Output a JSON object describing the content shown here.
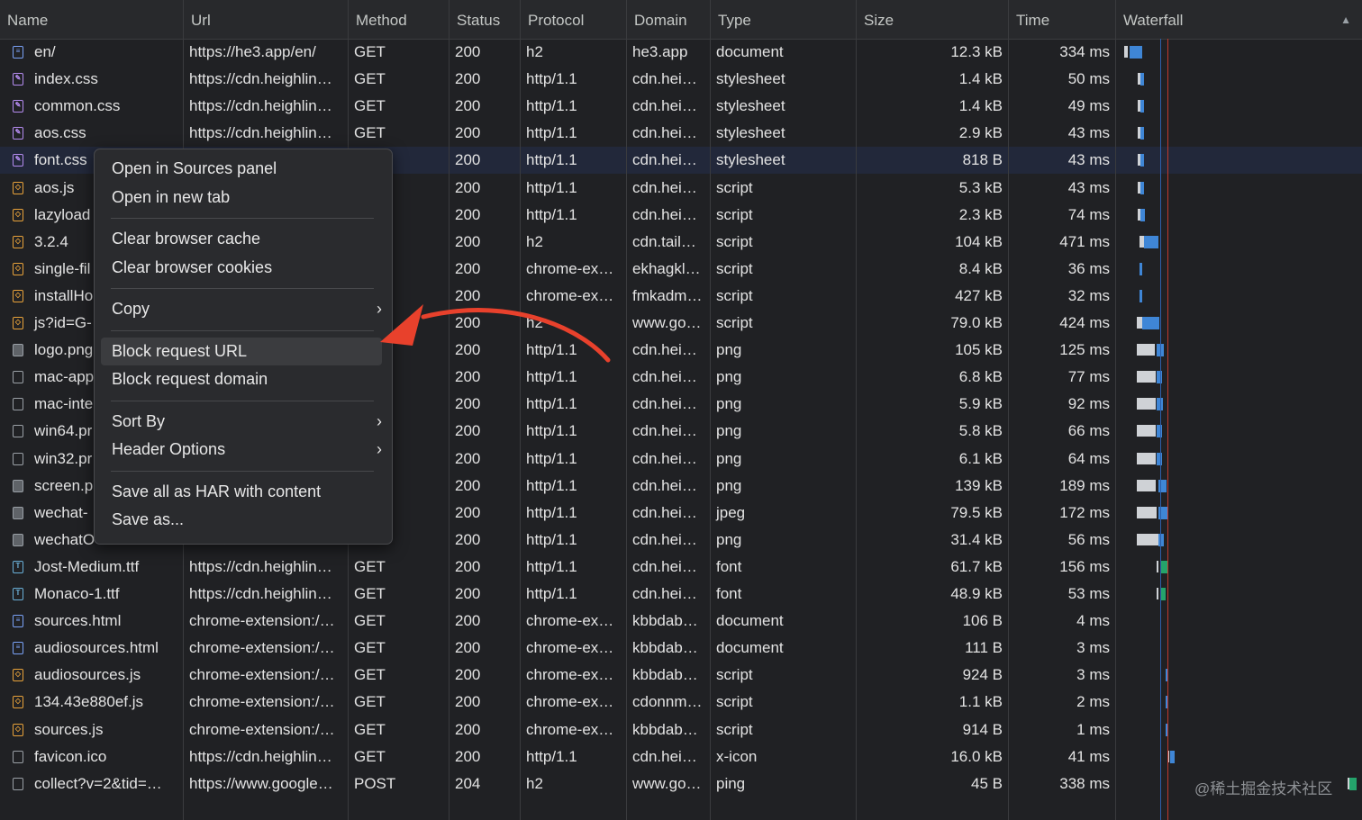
{
  "columns": [
    "Name",
    "Url",
    "Method",
    "Status",
    "Protocol",
    "Domain",
    "Type",
    "Size",
    "Time",
    "Waterfall"
  ],
  "sort_indicator": "▲",
  "rows": [
    {
      "icon": "doc",
      "name": "en/",
      "url": "https://he3.app/en/",
      "method": "GET",
      "status": "200",
      "protocol": "h2",
      "domain": "he3.app",
      "type": "document",
      "size": "12.3 kB",
      "time": "334 ms"
    },
    {
      "icon": "css",
      "name": "index.css",
      "url": "https://cdn.heighlin…",
      "method": "GET",
      "status": "200",
      "protocol": "http/1.1",
      "domain": "cdn.hei…",
      "type": "stylesheet",
      "size": "1.4 kB",
      "time": "50 ms"
    },
    {
      "icon": "css",
      "name": "common.css",
      "url": "https://cdn.heighlin…",
      "method": "GET",
      "status": "200",
      "protocol": "http/1.1",
      "domain": "cdn.hei…",
      "type": "stylesheet",
      "size": "1.4 kB",
      "time": "49 ms"
    },
    {
      "icon": "css",
      "name": "aos.css",
      "url": "https://cdn.heighlin…",
      "method": "GET",
      "status": "200",
      "protocol": "http/1.1",
      "domain": "cdn.hei…",
      "type": "stylesheet",
      "size": "2.9 kB",
      "time": "43 ms"
    },
    {
      "icon": "css",
      "name": "font.css",
      "url": "",
      "method": "",
      "status": "200",
      "protocol": "http/1.1",
      "domain": "cdn.hei…",
      "type": "stylesheet",
      "size": "818 B",
      "time": "43 ms"
    },
    {
      "icon": "js",
      "name": "aos.js",
      "url": "",
      "method": "",
      "status": "200",
      "protocol": "http/1.1",
      "domain": "cdn.hei…",
      "type": "script",
      "size": "5.3 kB",
      "time": "43 ms"
    },
    {
      "icon": "js",
      "name": "lazyload",
      "url": "",
      "method": "",
      "status": "200",
      "protocol": "http/1.1",
      "domain": "cdn.hei…",
      "type": "script",
      "size": "2.3 kB",
      "time": "74 ms"
    },
    {
      "icon": "js",
      "name": "3.2.4",
      "url": "",
      "method": "",
      "status": "200",
      "protocol": "h2",
      "domain": "cdn.tail…",
      "type": "script",
      "size": "104 kB",
      "time": "471 ms"
    },
    {
      "icon": "js",
      "name": "single-fil",
      "url": "",
      "method": "",
      "status": "200",
      "protocol": "chrome-ex…",
      "domain": "ekhagkl…",
      "type": "script",
      "size": "8.4 kB",
      "time": "36 ms"
    },
    {
      "icon": "js",
      "name": "installHo",
      "url": "",
      "method": "",
      "status": "200",
      "protocol": "chrome-ex…",
      "domain": "fmkadm…",
      "type": "script",
      "size": "427 kB",
      "time": "32 ms"
    },
    {
      "icon": "js",
      "name": "js?id=G-",
      "url": "",
      "method": "",
      "status": "200",
      "protocol": "h2",
      "domain": "www.go…",
      "type": "script",
      "size": "79.0 kB",
      "time": "424 ms"
    },
    {
      "icon": "img",
      "name": "logo.png",
      "url": "",
      "method": "",
      "status": "200",
      "protocol": "http/1.1",
      "domain": "cdn.hei…",
      "type": "png",
      "size": "105 kB",
      "time": "125 ms"
    },
    {
      "icon": "other",
      "name": "mac-app",
      "url": "",
      "method": "",
      "status": "200",
      "protocol": "http/1.1",
      "domain": "cdn.hei…",
      "type": "png",
      "size": "6.8 kB",
      "time": "77 ms"
    },
    {
      "icon": "other",
      "name": "mac-inte",
      "url": "",
      "method": "",
      "status": "200",
      "protocol": "http/1.1",
      "domain": "cdn.hei…",
      "type": "png",
      "size": "5.9 kB",
      "time": "92 ms"
    },
    {
      "icon": "other",
      "name": "win64.pr",
      "url": "",
      "method": "",
      "status": "200",
      "protocol": "http/1.1",
      "domain": "cdn.hei…",
      "type": "png",
      "size": "5.8 kB",
      "time": "66 ms"
    },
    {
      "icon": "other",
      "name": "win32.pr",
      "url": "",
      "method": "",
      "status": "200",
      "protocol": "http/1.1",
      "domain": "cdn.hei…",
      "type": "png",
      "size": "6.1 kB",
      "time": "64 ms"
    },
    {
      "icon": "img",
      "name": "screen.p",
      "url": "",
      "method": "",
      "status": "200",
      "protocol": "http/1.1",
      "domain": "cdn.hei…",
      "type": "png",
      "size": "139 kB",
      "time": "189 ms"
    },
    {
      "icon": "img",
      "name": "wechat-",
      "url": "",
      "method": "",
      "status": "200",
      "protocol": "http/1.1",
      "domain": "cdn.hei…",
      "type": "jpeg",
      "size": "79.5 kB",
      "time": "172 ms"
    },
    {
      "icon": "img",
      "name": "wechatO",
      "url": "",
      "method": "",
      "status": "200",
      "protocol": "http/1.1",
      "domain": "cdn.hei…",
      "type": "png",
      "size": "31.4 kB",
      "time": "56 ms"
    },
    {
      "icon": "font",
      "name": "Jost-Medium.ttf",
      "url": "https://cdn.heighlin…",
      "method": "GET",
      "status": "200",
      "protocol": "http/1.1",
      "domain": "cdn.hei…",
      "type": "font",
      "size": "61.7 kB",
      "time": "156 ms"
    },
    {
      "icon": "font",
      "name": "Monaco-1.ttf",
      "url": "https://cdn.heighlin…",
      "method": "GET",
      "status": "200",
      "protocol": "http/1.1",
      "domain": "cdn.hei…",
      "type": "font",
      "size": "48.9 kB",
      "time": "53 ms"
    },
    {
      "icon": "doc",
      "name": "sources.html",
      "url": "chrome-extension:/…",
      "method": "GET",
      "status": "200",
      "protocol": "chrome-ex…",
      "domain": "kbbdab…",
      "type": "document",
      "size": "106 B",
      "time": "4 ms"
    },
    {
      "icon": "doc",
      "name": "audiosources.html",
      "url": "chrome-extension:/…",
      "method": "GET",
      "status": "200",
      "protocol": "chrome-ex…",
      "domain": "kbbdab…",
      "type": "document",
      "size": "111 B",
      "time": "3 ms"
    },
    {
      "icon": "js",
      "name": "audiosources.js",
      "url": "chrome-extension:/…",
      "method": "GET",
      "status": "200",
      "protocol": "chrome-ex…",
      "domain": "kbbdab…",
      "type": "script",
      "size": "924 B",
      "time": "3 ms"
    },
    {
      "icon": "js",
      "name": "134.43e880ef.js",
      "url": "chrome-extension:/…",
      "method": "GET",
      "status": "200",
      "protocol": "chrome-ex…",
      "domain": "cdonnm…",
      "type": "script",
      "size": "1.1 kB",
      "time": "2 ms"
    },
    {
      "icon": "js",
      "name": "sources.js",
      "url": "chrome-extension:/…",
      "method": "GET",
      "status": "200",
      "protocol": "chrome-ex…",
      "domain": "kbbdab…",
      "type": "script",
      "size": "914 B",
      "time": "1 ms"
    },
    {
      "icon": "other",
      "name": "favicon.ico",
      "url": "https://cdn.heighlin…",
      "method": "GET",
      "status": "200",
      "protocol": "http/1.1",
      "domain": "cdn.hei…",
      "type": "x-icon",
      "size": "16.0 kB",
      "time": "41 ms"
    },
    {
      "icon": "other",
      "name": "collect?v=2&tid=…",
      "url": "https://www.google…",
      "method": "POST",
      "status": "204",
      "protocol": "h2",
      "domain": "www.go…",
      "type": "ping",
      "size": "45 B",
      "time": "338 ms"
    }
  ],
  "context_menu": {
    "groups": [
      [
        {
          "label": "Open in Sources panel",
          "submenu": false
        },
        {
          "label": "Open in new tab",
          "submenu": false
        }
      ],
      [
        {
          "label": "Clear browser cache",
          "submenu": false
        },
        {
          "label": "Clear browser cookies",
          "submenu": false
        }
      ],
      [
        {
          "label": "Copy",
          "submenu": true
        }
      ],
      [
        {
          "label": "Block request URL",
          "submenu": false,
          "highlighted": true
        },
        {
          "label": "Block request domain",
          "submenu": false
        }
      ],
      [
        {
          "label": "Sort By",
          "submenu": true
        },
        {
          "label": "Header Options",
          "submenu": true
        }
      ],
      [
        {
          "label": "Save all as HAR with content",
          "submenu": false
        },
        {
          "label": "Save as...",
          "submenu": false
        }
      ]
    ]
  },
  "watermark": "@稀土掘金技术社区",
  "colors": {
    "background": "#202124",
    "accent": "#3f86d6",
    "arrow": "#e8412c",
    "timeline_marker": "#c0392b"
  }
}
